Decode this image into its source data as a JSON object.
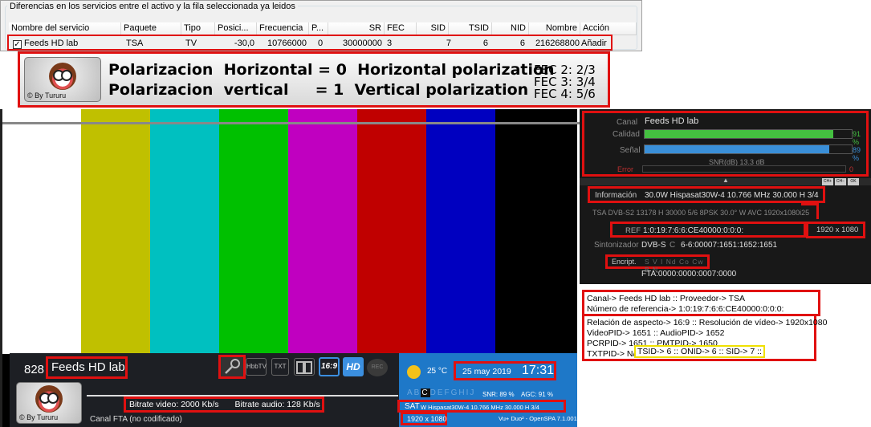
{
  "table": {
    "group_title": "Diferencias en los servicios entre el activo y la fila seleccionada ya leidos",
    "headers": [
      "Nombre del servicio",
      "Paquete",
      "Tipo",
      "Posici...",
      "Frecuencia",
      "P...",
      "SR",
      "FEC",
      "SID",
      "TSID",
      "NID",
      "Nombre",
      "Acción"
    ],
    "row": {
      "check": "✓",
      "name": "Feeds HD lab",
      "paquete": "TSA",
      "tipo": "TV",
      "posicion": "-30,0",
      "frecuencia": "10766000",
      "p": "0",
      "sr": "30000000",
      "fec": "3",
      "sid": "7",
      "tsid": "6",
      "nid": "6",
      "nombre": "216268800",
      "accion": "Añadir"
    }
  },
  "banner": {
    "logo_by": "© By Tururu",
    "line1": "Polarizacion  Horizontal = 0  Horizontal polarization",
    "line2": "Polarizacion  vertical     = 1  Vertical polarization",
    "fec2": "FEC 2: 2/3",
    "fec3": "FEC 3: 3/4",
    "fec4": "FEC 4: 5/6"
  },
  "osd": {
    "channel_number": "828",
    "channel_name": "Feeds HD lab",
    "icons": [
      "key-icon",
      "hbbtv-icon",
      "txt-icon",
      "dolby-icon",
      "16:9",
      "HD",
      "REC"
    ],
    "bitrate_video": "Bitrate video:  2000 Kb/s",
    "bitrate_audio": "Bitrate audio:  128 Kb/s",
    "canal_status": "Canal FTA (no codificado)",
    "logo_by": "© By Tururu",
    "temperature": "25 °C",
    "date": "25 may 2019",
    "time": "17:31",
    "letters": [
      "A",
      "B",
      "C",
      "D",
      "E",
      "F",
      "G",
      "H",
      "I",
      "J"
    ],
    "snr": "SNR:  89 %",
    "agc": "AGC:  91 %",
    "sat_label": "SAT",
    "sat_info": "W Hispasat30W-4 10.766 MHz 30.000 H 3/4",
    "resolution": "1920 x 1080",
    "receiver": "Vu+ Duo² - OpenSPA 7.1.001"
  },
  "panel": {
    "canal_label": "Canal",
    "canal_value": "Feeds HD lab",
    "calidad_label": "Calidad",
    "calidad_value": "91 %",
    "calidad_pct": 91,
    "senal_label": "Señal",
    "senal_value": "89 %",
    "senal_pct": 89,
    "snr_db": "SNR(dB)  13.3 dB",
    "error_label": "Error",
    "error_value": "0",
    "buttons": [
      "CH+",
      "CH−",
      "OK"
    ],
    "info_label": "Información",
    "info_value": "30.0W Hispasat30W-4 10.766 MHz 30.000 H 3/4",
    "tsa_line": "TSA DVB-S2 13178 H 30000 5/6 8PSK 30.0° W AVC 1920x1080i25",
    "ref_label": "REF",
    "ref_value": "1:0:19:7:6:6:CE40000:0:0:0:",
    "res_value": "1920 x 1080",
    "sint_label": "Sintonizador",
    "sint_value": "DVB-S",
    "sint_c": "C",
    "sint_pids": "6-6:00007:1651:1652:1651",
    "encript_label": "Encript.",
    "encript_value": "S V I Nd Co Cw B N",
    "fta": "FTA:0000:0000:0007:0000"
  },
  "info_box": {
    "l1": "Canal-> Feeds HD lab :: Proveedor-> TSA",
    "l2": "Número de referencia-> 1:0:19:7:6:6:CE40000:0:0:0:",
    "l3": "Relación de aspecto-> 16:9 :: Resolución de vídeo-> 1920x1080",
    "l4": "VideoPID-> 1651 :: AudioPID-> 1652",
    "l5": "PCRPID-> 1651 :: PMTPID-> 1650",
    "l6a": "TXTPID-> N/A ::",
    "l6b": "TSID-> 6 :: ONID-> 6 :: SID-> 7 ::"
  },
  "colors": {
    "highlight_red": "#e01010",
    "highlight_yellow": "#f0e000",
    "bars": [
      "#ffffff",
      "#c0c000",
      "#00c0c0",
      "#00c000",
      "#c000c0",
      "#c00000",
      "#0000c0"
    ],
    "quality_bar": "#44c040",
    "signal_bar": "#3a8fd8"
  }
}
